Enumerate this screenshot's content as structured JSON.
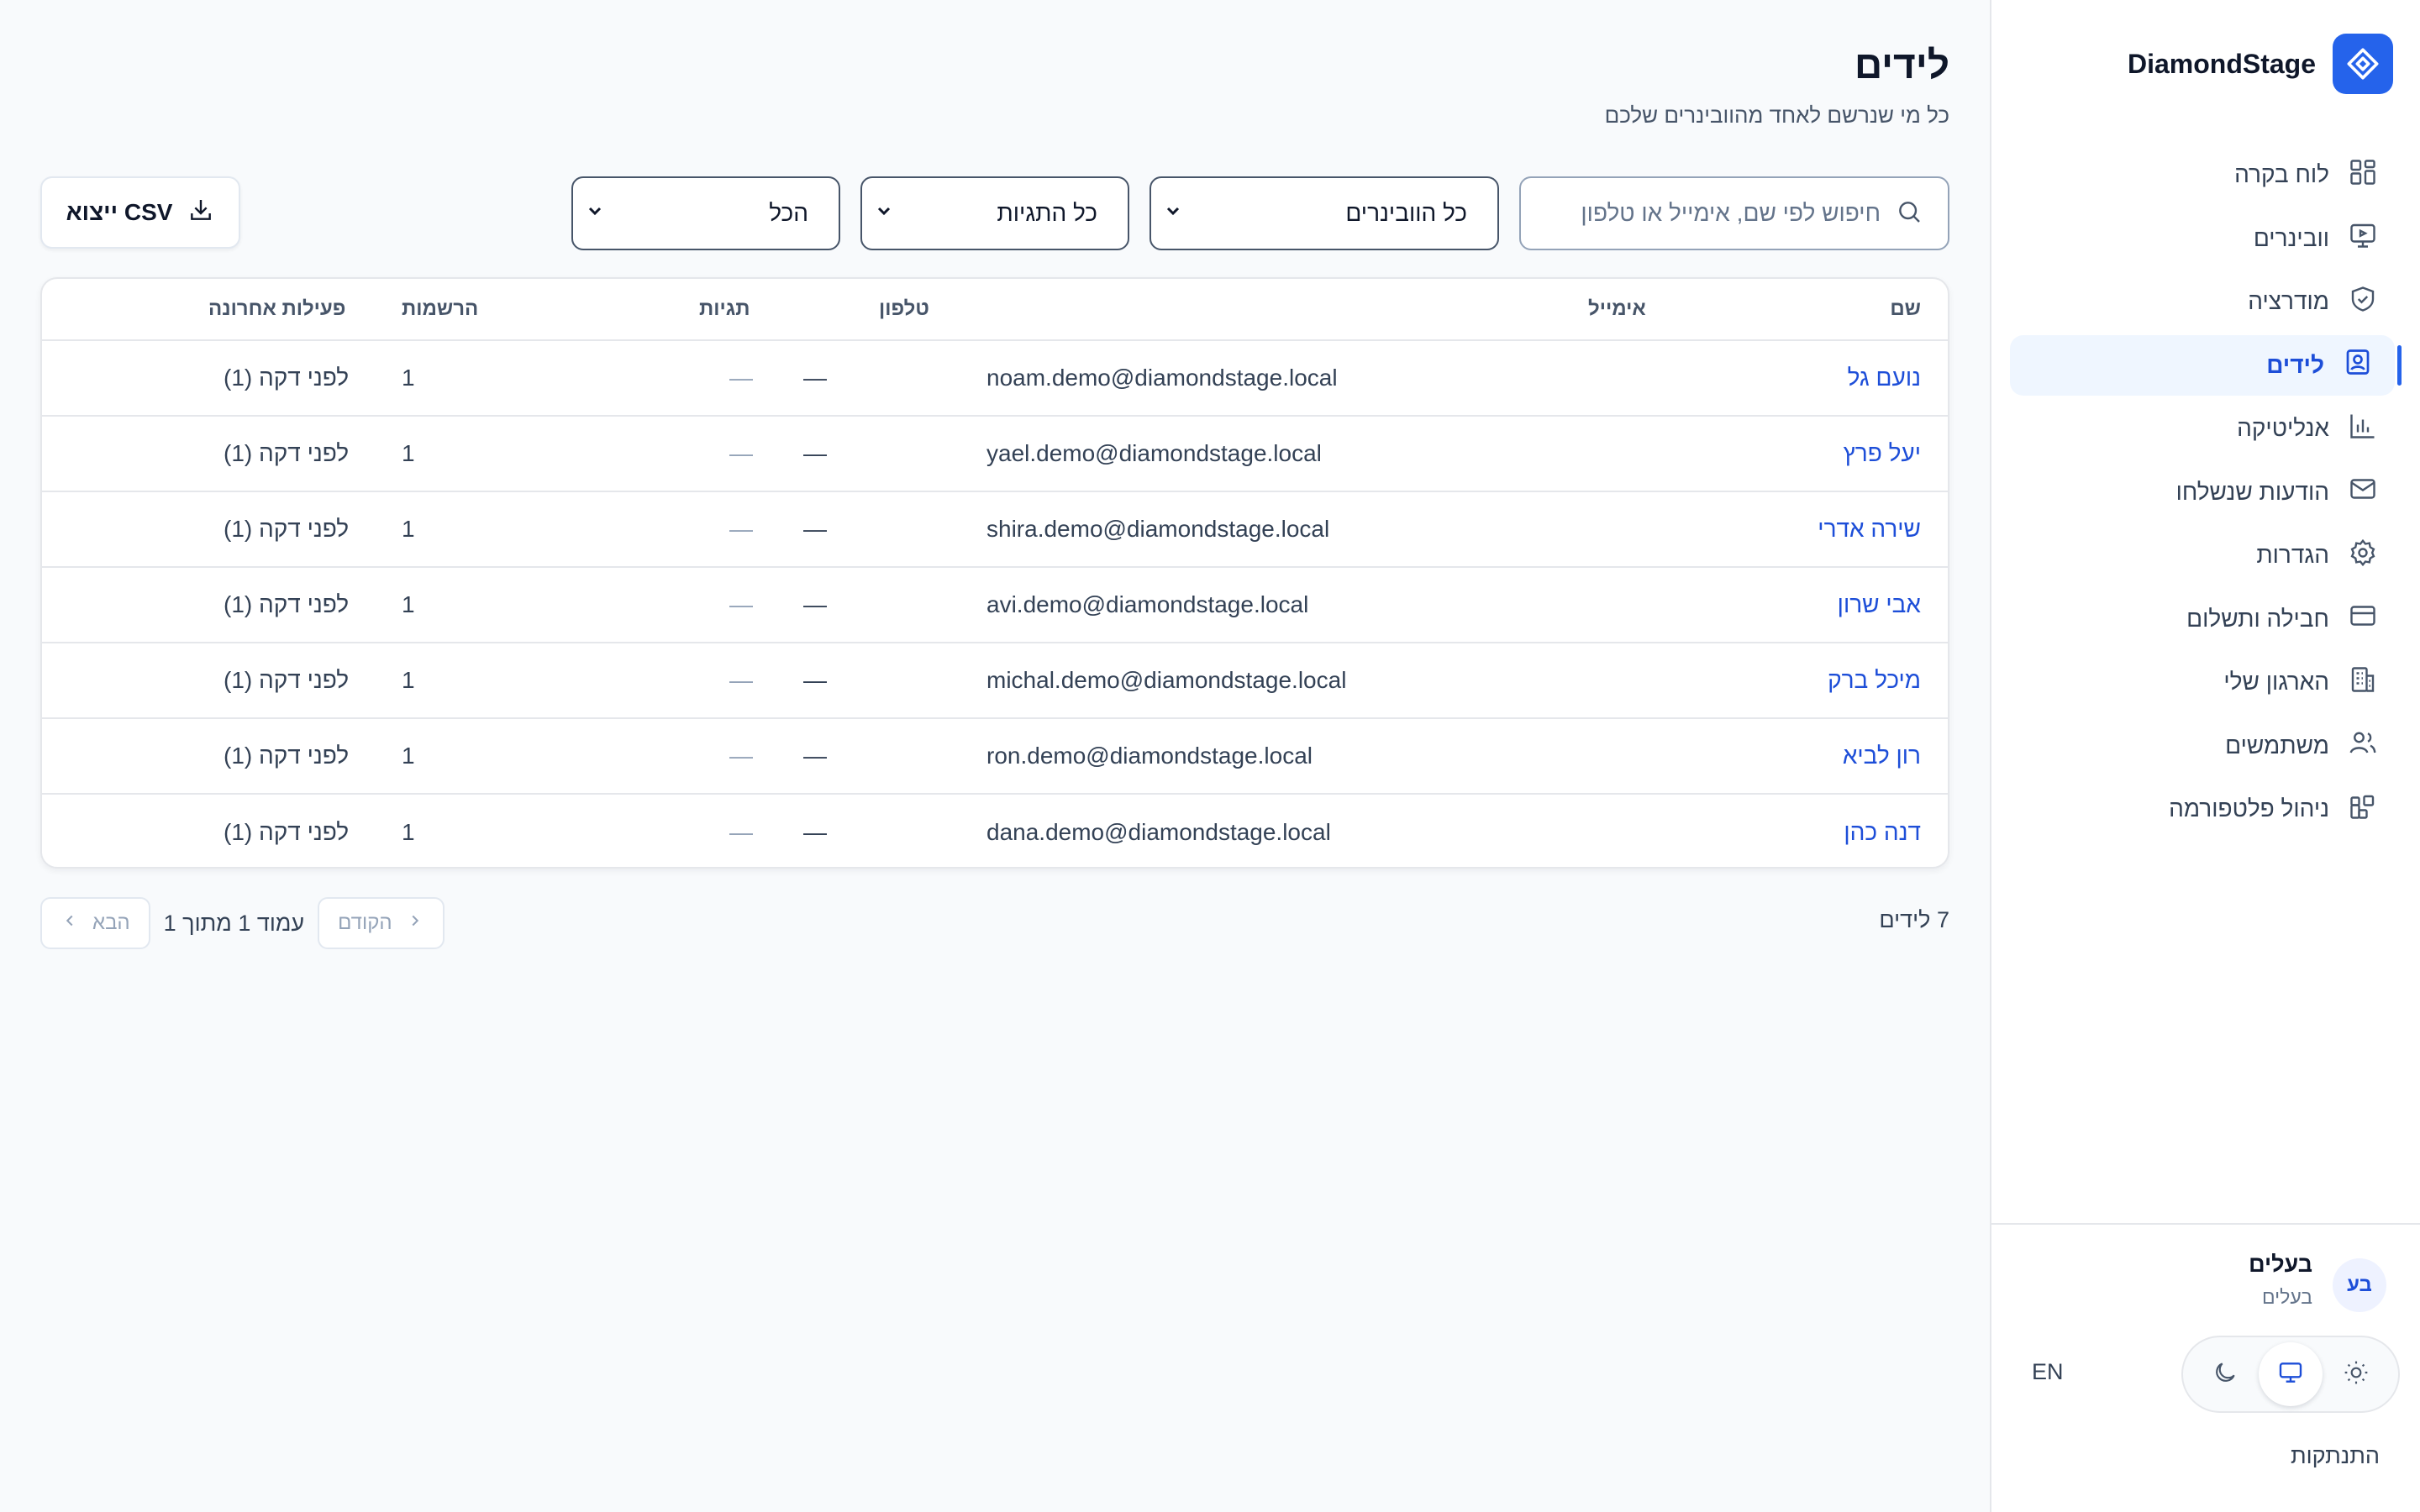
{
  "brand": {
    "name": "DiamondStage",
    "logo_icon": "diamond-icon",
    "accent": "#2563eb"
  },
  "nav": {
    "items": [
      {
        "label": "לוח בקרה",
        "icon": "dashboard-grid-icon"
      },
      {
        "label": "וובינרים",
        "icon": "presentation-screen-icon"
      },
      {
        "label": "מודרציה",
        "icon": "shield-check-icon"
      },
      {
        "label": "לידים",
        "icon": "contact-card-icon",
        "active": true
      },
      {
        "label": "אנליטיקה",
        "icon": "bar-chart-icon"
      },
      {
        "label": "הודעות שנשלחו",
        "icon": "mail-icon"
      },
      {
        "label": "הגדרות",
        "icon": "gear-icon"
      },
      {
        "label": "חבילה ותשלום",
        "icon": "credit-card-icon"
      },
      {
        "label": "הארגון שלי",
        "icon": "building-icon"
      },
      {
        "label": "משתמשים",
        "icon": "users-icon"
      },
      {
        "label": "ניהול פלטפורמה",
        "icon": "widgets-icon"
      }
    ]
  },
  "user": {
    "initials": "בע",
    "name": "בעלים",
    "role": "בעלים"
  },
  "theme": {
    "options": [
      "light",
      "system",
      "dark"
    ],
    "selected": "system"
  },
  "language_toggle": "EN",
  "logout_label": "התנתקות",
  "page": {
    "title": "לידים",
    "subtitle": "כל מי שנרשם לאחד מהוובינרים שלכם"
  },
  "filters": {
    "search_placeholder": "חיפוש לפי שם, אימייל או טלפון",
    "webinar_select": "כל הוובינרים",
    "tags_select": "כל התגיות",
    "all_select": "הכל"
  },
  "export_button": "ייצוא CSV",
  "table": {
    "columns": {
      "name": "שם",
      "email": "אימייל",
      "phone": "טלפון",
      "tags": "תגיות",
      "registrations": "הרשמות",
      "last_activity": "פעילות אחרונה"
    },
    "rows": [
      {
        "name": "נועם גל",
        "email": "noam.demo@diamondstage.local",
        "phone": "—",
        "tags": "—",
        "registrations": "1",
        "last_activity": "לפני דקה (1)"
      },
      {
        "name": "יעל פרץ",
        "email": "yael.demo@diamondstage.local",
        "phone": "—",
        "tags": "—",
        "registrations": "1",
        "last_activity": "לפני דקה (1)"
      },
      {
        "name": "שירה אדרי",
        "email": "shira.demo@diamondstage.local",
        "phone": "—",
        "tags": "—",
        "registrations": "1",
        "last_activity": "לפני דקה (1)"
      },
      {
        "name": "אבי שרון",
        "email": "avi.demo@diamondstage.local",
        "phone": "—",
        "tags": "—",
        "registrations": "1",
        "last_activity": "לפני דקה (1)"
      },
      {
        "name": "מיכל ברק",
        "email": "michal.demo@diamondstage.local",
        "phone": "—",
        "tags": "—",
        "registrations": "1",
        "last_activity": "לפני דקה (1)"
      },
      {
        "name": "רון לביא",
        "email": "ron.demo@diamondstage.local",
        "phone": "—",
        "tags": "—",
        "registrations": "1",
        "last_activity": "לפני דקה (1)"
      },
      {
        "name": "דנה כהן",
        "email": "dana.demo@diamondstage.local",
        "phone": "—",
        "tags": "—",
        "registrations": "1",
        "last_activity": "לפני דקה (1)"
      }
    ]
  },
  "pagination": {
    "total_label": "7 לידים",
    "prev_label": "הקודם",
    "next_label": "הבא",
    "page_info": "עמוד 1 מתוך 1"
  }
}
